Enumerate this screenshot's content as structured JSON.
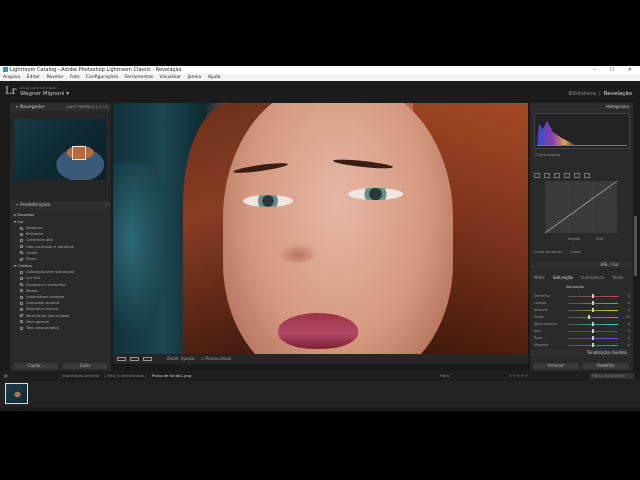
{
  "window": {
    "title": "Lightroom Catalog - Adobe Photoshop Lightroom Classic - Revelação",
    "controls": "–  ☐  ✕"
  },
  "menu": [
    "Arquivo",
    "Editar",
    "Revelar",
    "Foto",
    "Configurações",
    "Ferramentas",
    "Visualizar",
    "Janela",
    "Ajuda"
  ],
  "identity": {
    "logo": "Lr",
    "small": "Adobe Lightroom Classic",
    "user": "Wagner Mignoni",
    "caret": "▾"
  },
  "modules": {
    "library": "Biblioteca",
    "separator": "|",
    "develop": "Revelação"
  },
  "left_panel": {
    "navigator_title": "Navegador",
    "navigator_opts": "AJUST   PREENCH   1:1   3:1",
    "presets_title": "Predefinições",
    "presets_add": "+",
    "favorites": "Favoritos",
    "groups": [
      {
        "name": "Cor",
        "items": [
          "Moderno",
          "Brilhante",
          "Contraste alto",
          "Alto contraste e detalhes",
          "Vívido",
          "Plano"
        ]
      },
      {
        "name": "Criativo",
        "items": [
          "Coloração sem saturação",
          "Luz fria",
          "Duquesa e vermelho",
          "Meses",
          "Instantâneo vintage",
          "Contraste quente",
          "Simples e escuro",
          "Manhãs de fosco baixo",
          "Tons opacos",
          "Tons ensolarados"
        ]
      }
    ],
    "copy_button": "Copiar...",
    "paste_button": "Colar"
  },
  "toolbar": {
    "zoom_label": "Zoom",
    "zoom_value": "Ajustar",
    "soft_proof": "Prova virtual"
  },
  "right_panel": {
    "histogram_title": "Histograma",
    "original_photo": "Foto original",
    "curve_region": "Região",
    "curve_channel": "RGB",
    "curve_point": "Curva de ponto:",
    "curve_point_value": "Linear",
    "hsl_header": "HSL / Cor",
    "hsl_tabs": [
      "Matiz",
      "Saturação",
      "Luminância",
      "Todos"
    ],
    "saturation_group": "Saturação",
    "sliders": [
      {
        "name": "Vermelho",
        "value": "0",
        "level": 0.5
      },
      {
        "name": "Laranja",
        "value": "0",
        "level": 0.5
      },
      {
        "name": "Amarelo",
        "value": "0",
        "level": 0.5
      },
      {
        "name": "Verde",
        "value": "– 16",
        "level": 0.42
      },
      {
        "name": "Água-marinha",
        "value": "0",
        "level": 0.5
      },
      {
        "name": "Azul",
        "value": "0",
        "level": 0.5
      },
      {
        "name": "Roxo",
        "value": "0",
        "level": 0.5
      },
      {
        "name": "Magenta",
        "value": "0",
        "level": 0.5
      }
    ],
    "split_toning": "Tonalização dividida",
    "previous_button": "Anterior",
    "reset_button": "Redefinir"
  },
  "filmstrip": {
    "breadcrumb": "Importação anterior",
    "count": "1 foto /1 selecionada /",
    "filename": "Plano de fundo1.png",
    "filter_label": "Filtro:",
    "stars": "★★★★★",
    "filter_value": "Filtros desativados"
  },
  "colors": {
    "accent_panel": "#2a2a2a",
    "background": "#1a1a1a",
    "text": "#bdbdbd"
  }
}
